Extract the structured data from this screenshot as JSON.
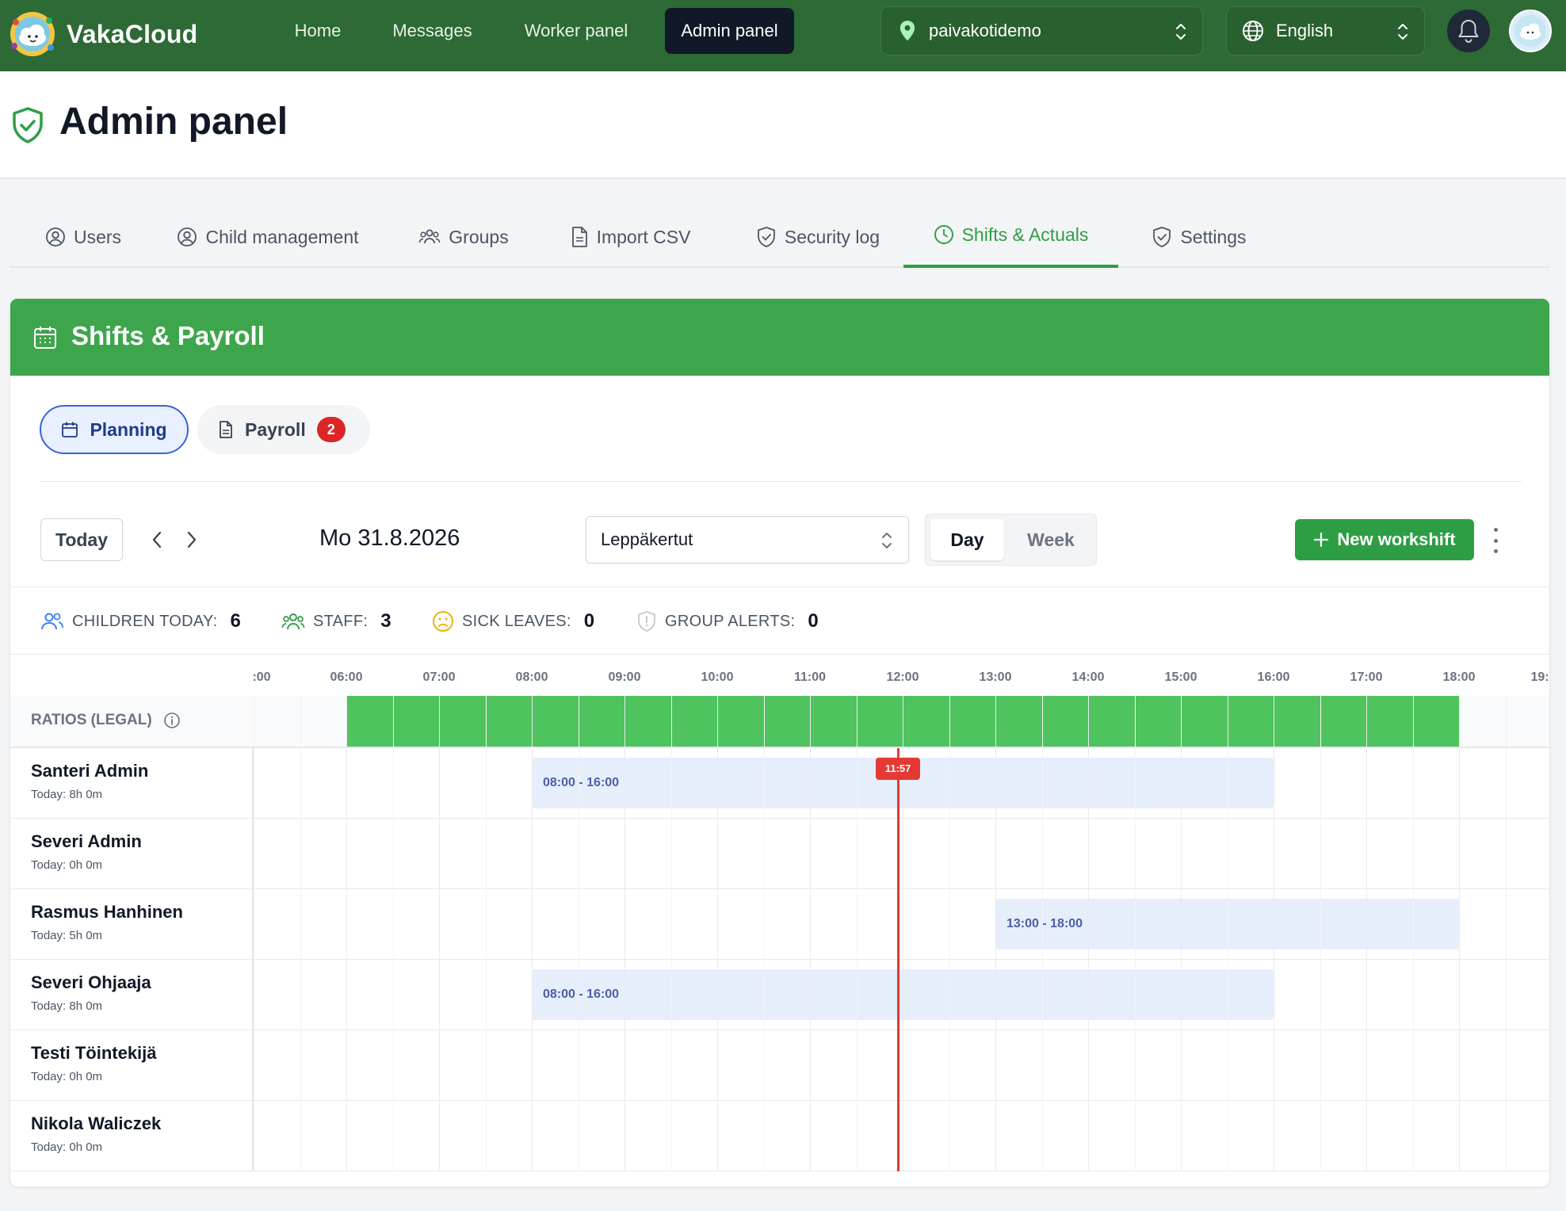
{
  "brand": {
    "name": "VakaCloud"
  },
  "nav": {
    "items": [
      {
        "label": "Home"
      },
      {
        "label": "Messages"
      },
      {
        "label": "Worker panel"
      },
      {
        "label": "Admin panel",
        "active": true
      }
    ],
    "location": "paivakotidemo",
    "language": "English"
  },
  "header": {
    "title": "Admin panel"
  },
  "tabs": [
    {
      "label": "Users",
      "icon": "user-circle-icon"
    },
    {
      "label": "Child management",
      "icon": "user-circle-icon"
    },
    {
      "label": "Groups",
      "icon": "users-icon"
    },
    {
      "label": "Import CSV",
      "icon": "file-icon"
    },
    {
      "label": "Security log",
      "icon": "shield-check-icon"
    },
    {
      "label": "Shifts & Actuals",
      "icon": "clock-icon",
      "active": true
    },
    {
      "label": "Settings",
      "icon": "shield-check-icon"
    }
  ],
  "card": {
    "title": "Shifts & Payroll",
    "subtabs": {
      "planning": "Planning",
      "payroll": "Payroll",
      "payroll_badge": "2"
    },
    "toolbar": {
      "today": "Today",
      "date": "Mo 31.8.2026",
      "group": "Leppäkertut",
      "view_day": "Day",
      "view_week": "Week",
      "new_workshift": "New workshift"
    },
    "stats": {
      "children_label": "CHILDREN TODAY:",
      "children_value": "6",
      "staff_label": "STAFF:",
      "staff_value": "3",
      "sick_label": "SICK LEAVES:",
      "sick_value": "0",
      "alerts_label": "GROUP ALERTS:",
      "alerts_value": "0"
    }
  },
  "timeline": {
    "ticks": [
      ":00",
      "06:00",
      "07:00",
      "08:00",
      "09:00",
      "10:00",
      "11:00",
      "12:00",
      "13:00",
      "14:00",
      "15:00",
      "16:00",
      "17:00",
      "18:00",
      "19:"
    ],
    "ratios_label": "RATIOS (LEGAL)",
    "now_label": "11:57",
    "employees": [
      {
        "name": "Santeri Admin",
        "hours": "Today: 8h 0m",
        "shift": "08:00 - 16:00"
      },
      {
        "name": "Severi Admin",
        "hours": "Today: 0h 0m",
        "shift": ""
      },
      {
        "name": "Rasmus Hanhinen",
        "hours": "Today: 5h 0m",
        "shift": "13:00 - 18:00"
      },
      {
        "name": "Severi Ohjaaja",
        "hours": "Today: 8h 0m",
        "shift": "08:00 - 16:00"
      },
      {
        "name": "Testi Töintekijä",
        "hours": "Today: 0h 0m",
        "shift": ""
      },
      {
        "name": "Nikola Waliczek",
        "hours": "Today: 0h 0m",
        "shift": ""
      }
    ]
  },
  "colors": {
    "nav_bg": "#2d6a35",
    "accent_green": "#3da64c",
    "ratio_green": "#4fc35e",
    "now_red": "#e53935",
    "shift_blue": "#e6eefc"
  }
}
